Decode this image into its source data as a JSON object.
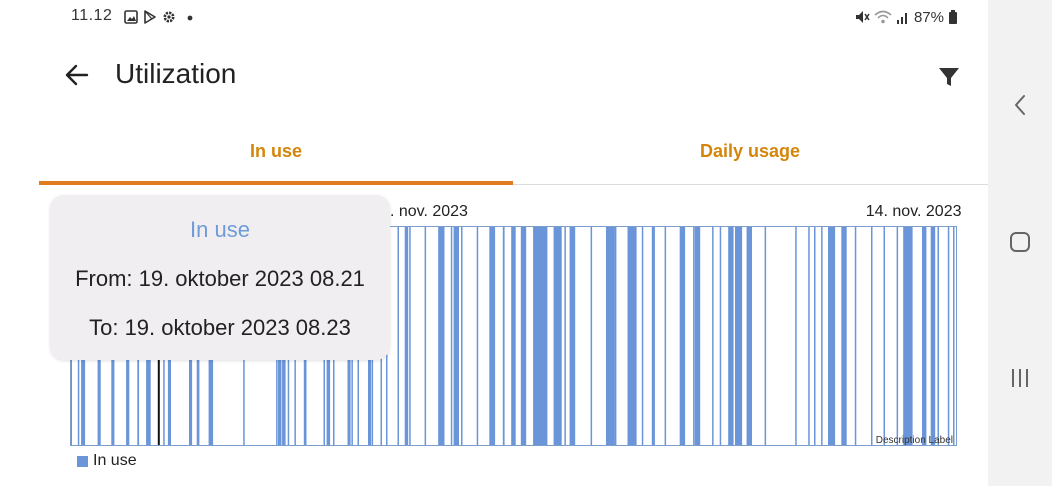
{
  "status_bar": {
    "time": "11.12",
    "battery": "87%",
    "icons_left": [
      "image-icon",
      "play-store-icon",
      "settings-icon",
      "dot-icon"
    ],
    "icons_right": [
      "mute-icon",
      "wifi-icon",
      "signal-icon",
      "battery-icon"
    ]
  },
  "app_bar": {
    "title": "Utilization",
    "back_icon": "arrow-left-icon",
    "filter_icon": "filter-icon"
  },
  "tabs": [
    {
      "label": "In use",
      "active": true
    },
    {
      "label": "Daily usage",
      "active": false
    }
  ],
  "tooltip": {
    "title": "In use",
    "from": "From: 19. oktober 2023 08.21",
    "to": "To: 19. oktober 2023 08.23"
  },
  "chart_data": {
    "type": "bar",
    "x_tick_labels": [
      {
        "label": "3. nov. 2023",
        "pos": 0.3995
      },
      {
        "label": "14. nov. 2023",
        "pos": 0.9516
      }
    ],
    "description": "Description Label",
    "legend": {
      "label": "In use",
      "color": "#6a95d9"
    },
    "series_color": "#6a95d9",
    "events": [
      {
        "t": 0.0,
        "w": 0.001
      },
      {
        "t": 0.0082,
        "w": 0.0012
      },
      {
        "t": 0.012,
        "w": 0.0045
      },
      {
        "t": 0.0306,
        "w": 0.0035
      },
      {
        "t": 0.0461,
        "w": 0.0035
      },
      {
        "t": 0.0629,
        "w": 0.0035
      },
      {
        "t": 0.0629,
        "w": 0.0015
      },
      {
        "t": 0.0754,
        "w": 0.002
      },
      {
        "t": 0.0853,
        "w": 0.0035
      },
      {
        "t": 0.0885,
        "w": 0.002
      },
      {
        "t": 0.1046,
        "w": 0.0012
      },
      {
        "t": 0.1099,
        "w": 0.0035
      },
      {
        "t": 0.1338,
        "w": 0.0035
      },
      {
        "t": 0.1337,
        "w": 0.0015
      },
      {
        "t": 0.1424,
        "w": 0.003
      },
      {
        "t": 0.1559,
        "w": 0.002
      },
      {
        "t": 0.1574,
        "w": 0.0035
      },
      {
        "t": 0.1949,
        "w": 0.0012
      },
      {
        "t": 0.232,
        "w": 0.0012
      },
      {
        "t": 0.2342,
        "w": 0.004
      },
      {
        "t": 0.2388,
        "w": 0.004
      },
      {
        "t": 0.2451,
        "w": 0.0012
      },
      {
        "t": 0.2527,
        "w": 0.0012
      },
      {
        "t": 0.2633,
        "w": 0.003
      },
      {
        "t": 0.2856,
        "w": 0.0012
      },
      {
        "t": 0.289,
        "w": 0.004
      },
      {
        "t": 0.2963,
        "w": 0.0015
      },
      {
        "t": 0.3126,
        "w": 0.0035
      },
      {
        "t": 0.317,
        "w": 0.0015
      },
      {
        "t": 0.3239,
        "w": 0.0012
      },
      {
        "t": 0.3358,
        "w": 0.0035
      },
      {
        "t": 0.3398,
        "w": 0.0015
      },
      {
        "t": 0.3499,
        "w": 0.0012
      },
      {
        "t": 0.3561,
        "w": 0.0012
      },
      {
        "t": 0.3691,
        "w": 0.0012
      },
      {
        "t": 0.3772,
        "w": 0.004
      },
      {
        "t": 0.3823,
        "w": 0.0012
      },
      {
        "t": 0.3997,
        "w": 0.0015
      },
      {
        "t": 0.4151,
        "w": 0.0015
      },
      {
        "t": 0.4292,
        "w": 0.0015
      },
      {
        "t": 0.4325,
        "w": 0.004
      },
      {
        "t": 0.4408,
        "w": 0.0012
      },
      {
        "t": 0.4585,
        "w": 0.0012
      },
      {
        "t": 0.4728,
        "w": 0.004
      },
      {
        "t": 0.4775,
        "w": 0.0015
      },
      {
        "t": 0.4879,
        "w": 0.002
      },
      {
        "t": 0.4975,
        "w": 0.0015
      },
      {
        "t": 0.5083,
        "w": 0.0015
      },
      {
        "t": 0.5222,
        "w": 0.013
      },
      {
        "t": 0.5358,
        "w": 0.0015
      },
      {
        "t": 0.5454,
        "w": 0.007
      },
      {
        "t": 0.5575,
        "w": 0.0015
      },
      {
        "t": 0.5634,
        "w": 0.004
      },
      {
        "t": 0.568,
        "w": 0.0015
      },
      {
        "t": 0.587,
        "w": 0.0012
      },
      {
        "t": 0.6044,
        "w": 0.008
      },
      {
        "t": 0.6144,
        "w": 0.0015
      },
      {
        "t": 0.6287,
        "w": 0.007
      },
      {
        "t": 0.6372,
        "w": 0.0015
      },
      {
        "t": 0.6448,
        "w": 0.0012
      },
      {
        "t": 0.6561,
        "w": 0.0035
      },
      {
        "t": 0.6705,
        "w": 0.0012
      },
      {
        "t": 0.6877,
        "w": 0.0015
      },
      {
        "t": 0.7027,
        "w": 0.0012
      },
      {
        "t": 0.7047,
        "w": 0.004
      },
      {
        "t": 0.7242,
        "w": 0.0012
      },
      {
        "t": 0.7327,
        "w": 0.0012
      },
      {
        "t": 0.7424,
        "w": 0.0015
      },
      {
        "t": 0.75,
        "w": 0.005
      },
      {
        "t": 0.7632,
        "w": 0.0015
      },
      {
        "t": 0.7834,
        "w": 0.0012
      },
      {
        "t": 0.8179,
        "w": 0.0012
      },
      {
        "t": 0.8326,
        "w": 0.0012
      },
      {
        "t": 0.8392,
        "w": 0.0012
      },
      {
        "t": 0.8472,
        "w": 0.0012
      },
      {
        "t": 0.855,
        "w": 0.007
      },
      {
        "t": 0.8701,
        "w": 0.0015
      },
      {
        "t": 0.8852,
        "w": 0.0012
      },
      {
        "t": 0.9035,
        "w": 0.0012
      },
      {
        "t": 0.9176,
        "w": 0.0012
      },
      {
        "t": 0.9324,
        "w": 0.0012
      },
      {
        "t": 0.94,
        "w": 0.0035
      },
      {
        "t": 0.9455,
        "w": 0.0015
      },
      {
        "t": 0.9611,
        "w": 0.0015
      },
      {
        "t": 0.971,
        "w": 0.0015
      },
      {
        "t": 0.9785,
        "w": 0.0015
      },
      {
        "t": 0.9902,
        "w": 0.0012
      },
      {
        "t": 0.996,
        "w": 0.0012
      }
    ],
    "thick_events": [
      {
        "t": 0.4151,
        "w": 0.007
      },
      {
        "t": 0.4325,
        "w": 0.006
      },
      {
        "t": 0.4728,
        "w": 0.005
      },
      {
        "t": 0.4975,
        "w": 0.005
      },
      {
        "t": 0.5083,
        "w": 0.006
      },
      {
        "t": 0.5222,
        "w": 0.016
      },
      {
        "t": 0.5454,
        "w": 0.009
      },
      {
        "t": 0.5634,
        "w": 0.006
      },
      {
        "t": 0.6044,
        "w": 0.01
      },
      {
        "t": 0.6287,
        "w": 0.009
      },
      {
        "t": 0.6877,
        "w": 0.006
      },
      {
        "t": 0.7047,
        "w": 0.006
      },
      {
        "t": 0.7424,
        "w": 0.006
      },
      {
        "t": 0.75,
        "w": 0.008
      },
      {
        "t": 0.7632,
        "w": 0.006
      },
      {
        "t": 0.855,
        "w": 0.008
      },
      {
        "t": 0.8701,
        "w": 0.006
      },
      {
        "t": 0.94,
        "w": 0.006
      },
      {
        "t": 0.9455,
        "w": 0.005
      },
      {
        "t": 0.9611,
        "w": 0.005
      },
      {
        "t": 0.971,
        "w": 0.005
      }
    ],
    "highlight_marker": 0.0985
  }
}
